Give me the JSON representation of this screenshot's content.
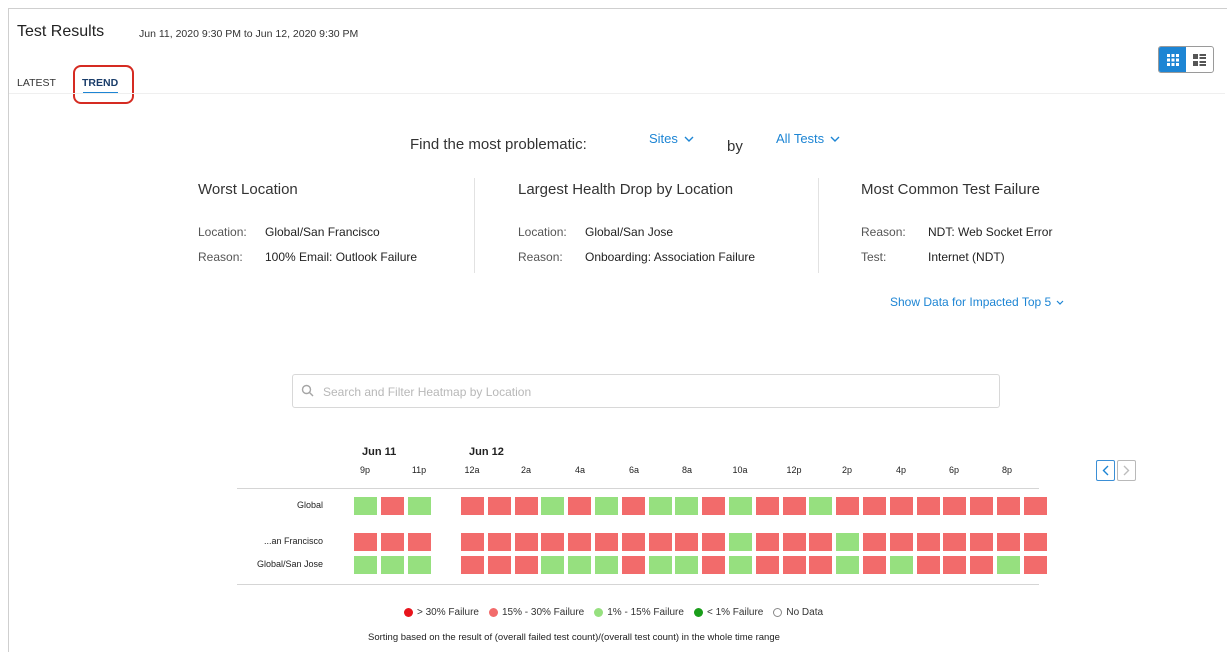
{
  "header": {
    "title": "Test Results",
    "date_range": "Jun 11, 2020 9:30 PM to Jun 12, 2020 9:30 PM"
  },
  "view_toggle": {
    "active": "grid-view",
    "items": [
      "grid-view",
      "card-view"
    ]
  },
  "tabs": [
    {
      "label": "LATEST",
      "active": false
    },
    {
      "label": "TREND",
      "active": true
    }
  ],
  "finder": {
    "prefix": "Find the most problematic:",
    "scope_select": "Sites",
    "by": "by",
    "test_select": "All Tests"
  },
  "cards": [
    {
      "title": "Worst Location",
      "rows": [
        {
          "label": "Location:",
          "value": "Global/San Francisco"
        },
        {
          "label": "Reason:",
          "value": "100% Email: Outlook Failure"
        }
      ]
    },
    {
      "title": "Largest Health Drop by Location",
      "rows": [
        {
          "label": "Location:",
          "value": "Global/San Jose"
        },
        {
          "label": "Reason:",
          "value": "Onboarding: Association Failure"
        }
      ]
    },
    {
      "title": "Most Common Test Failure",
      "rows": [
        {
          "label": "Reason:",
          "value": "NDT: Web Socket Error"
        },
        {
          "label": "Test:",
          "value": "Internet (NDT)"
        }
      ]
    }
  ],
  "show_top5": "Show Data for Impacted Top 5",
  "search": {
    "placeholder": "Search and Filter Heatmap by Location",
    "value": ""
  },
  "heatmap": {
    "dates": [
      "Jun 11",
      "Jun 12"
    ],
    "ticks": [
      "9p",
      "11p",
      "12a",
      "2a",
      "4a",
      "6a",
      "8a",
      "10a",
      "12p",
      "2p",
      "4p",
      "6p",
      "8p"
    ],
    "rows": [
      {
        "name": "Global",
        "before": [
          "light",
          "medium",
          "light"
        ],
        "after": [
          "medium",
          "medium",
          "medium",
          "light",
          "medium",
          "light",
          "medium",
          "light",
          "light",
          "medium",
          "light",
          "medium",
          "medium",
          "light",
          "medium",
          "medium",
          "medium",
          "medium",
          "medium",
          "medium",
          "medium",
          "medium"
        ]
      },
      {
        "name": "...an Francisco",
        "before": [
          "medium",
          "medium",
          "medium"
        ],
        "after": [
          "medium",
          "medium",
          "medium",
          "medium",
          "medium",
          "medium",
          "medium",
          "medium",
          "medium",
          "medium",
          "light",
          "medium",
          "medium",
          "medium",
          "light",
          "medium",
          "medium",
          "medium",
          "medium",
          "medium",
          "medium",
          "medium"
        ]
      },
      {
        "name": "Global/San Jose",
        "before": [
          "light",
          "light",
          "light"
        ],
        "after": [
          "medium",
          "medium",
          "medium",
          "light",
          "light",
          "light",
          "medium",
          "light",
          "light",
          "medium",
          "light",
          "medium",
          "medium",
          "medium",
          "light",
          "medium",
          "light",
          "medium",
          "medium",
          "medium",
          "light",
          "medium"
        ]
      }
    ],
    "colors": {
      "severe": "#e8141c",
      "medium": "#f26b6b",
      "light": "#96e07f",
      "good": "#1a9e1a",
      "nodata": "#ffffff"
    }
  },
  "legend": [
    {
      "label": "> 30% Failure",
      "color": "#e8141c"
    },
    {
      "label": "15% - 30% Failure",
      "color": "#f26b6b"
    },
    {
      "label": "1% - 15% Failure",
      "color": "#96e07f"
    },
    {
      "label": "< 1% Failure",
      "color": "#1a9e1a"
    },
    {
      "label": "No Data",
      "color": "#ffffff"
    }
  ],
  "sorting_note": "Sorting based on the result of (overall failed test count)/(overall test count) in the whole time range",
  "accent_color": "#1d85d4",
  "highlight_color": "#d52b22"
}
